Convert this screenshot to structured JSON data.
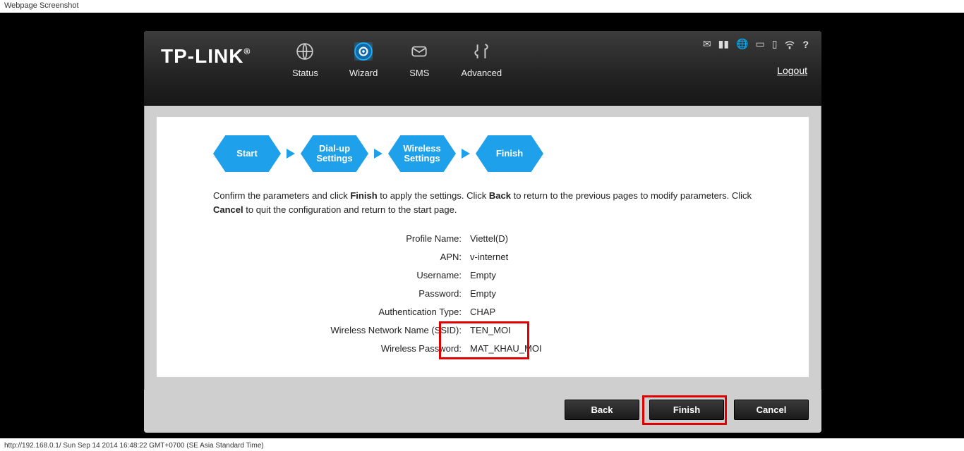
{
  "page_label": "Webpage Screenshot",
  "footer": "http://192.168.0.1/ Sun Sep 14 2014 16:48:22 GMT+0700 (SE Asia Standard Time)",
  "logo": "TP-LINK",
  "nav": {
    "status": "Status",
    "wizard": "Wizard",
    "sms": "SMS",
    "advanced": "Advanced"
  },
  "logout": "Logout",
  "steps": {
    "start": "Start",
    "dialup": "Dial-up Settings",
    "wireless": "Wireless Settings",
    "finish": "Finish"
  },
  "instruction": {
    "part1": "Confirm the parameters and click ",
    "b1": "Finish",
    "part2": " to apply the settings. Click ",
    "b2": "Back",
    "part3": " to return to the previous pages to modify parameters. Click ",
    "b3": "Cancel",
    "part4": " to quit the configuration and return to the start page."
  },
  "params": {
    "profile_name": {
      "label": "Profile Name:",
      "value": "Viettel(D)"
    },
    "apn": {
      "label": "APN:",
      "value": "v-internet"
    },
    "username": {
      "label": "Username:",
      "value": "Empty"
    },
    "password": {
      "label": "Password:",
      "value": "Empty"
    },
    "auth": {
      "label": "Authentication Type:",
      "value": "CHAP"
    },
    "ssid": {
      "label": "Wireless Network Name (SSID):",
      "value": "TEN_MOI"
    },
    "wpass": {
      "label": "Wireless Password:",
      "value": "MAT_KHAU_MOI"
    }
  },
  "buttons": {
    "back": "Back",
    "finish": "Finish",
    "cancel": "Cancel"
  }
}
